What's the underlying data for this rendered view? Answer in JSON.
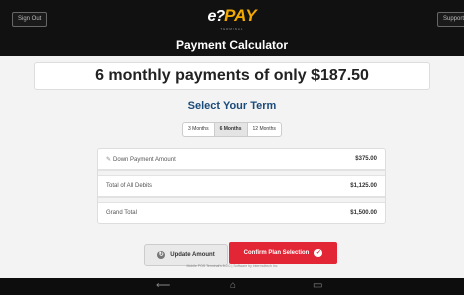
{
  "topbar": {
    "signout_label": "Sign Out",
    "support_label": "Support",
    "logo_mark": "e?",
    "logo_text": "PAY",
    "logo_sub": "TERMINAL",
    "title": "Payment Calculator"
  },
  "summary": {
    "headline": "6 monthly payments of only $187.50"
  },
  "term": {
    "title": "Select Your Term",
    "options": [
      "3 Months",
      "6 Months",
      "12 Months"
    ],
    "selected": "6 Months"
  },
  "table": {
    "rows": [
      {
        "label": "Down Payment Amount",
        "value": "$375.00"
      },
      {
        "label": "Total of All Debits",
        "value": "$1,125.00"
      },
      {
        "label": "Grand Total",
        "value": "$1,500.00"
      }
    ]
  },
  "actions": {
    "update_label": "Update Amount",
    "confirm_label": "Confirm Plan Selection"
  },
  "footer": {
    "text": "Mobile POS Terminal's 5.0.0 | Software by intermoltech Inc"
  },
  "icons": {
    "update": "refresh-icon",
    "confirm": "check-icon",
    "pencil": "pencil-icon",
    "back": "back-icon",
    "home": "home-icon",
    "recent": "recent-apps-icon"
  },
  "colors": {
    "accent_red": "#e32636",
    "term_title": "#1a4a7a",
    "logo_orange": "#f2a900"
  }
}
